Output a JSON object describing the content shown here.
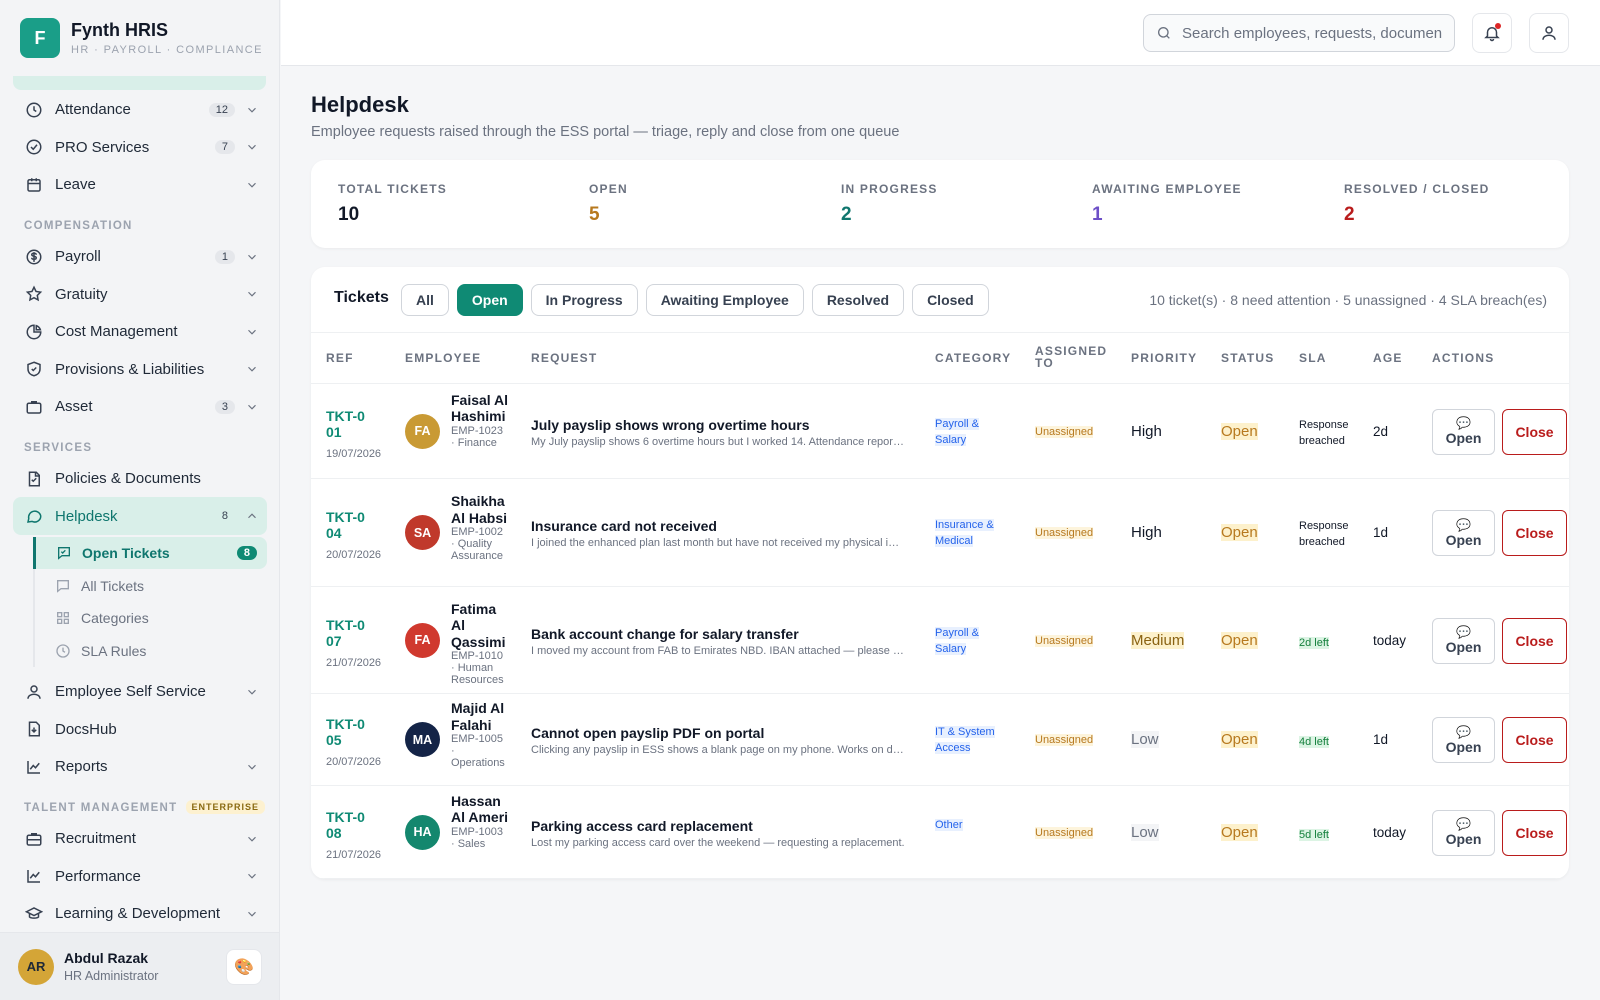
{
  "brand": {
    "logo_letter": "F",
    "name": "Fynth HRIS",
    "sub": "HR · PAYROLL · COMPLIANCE"
  },
  "sidebar": {
    "items_top": [
      {
        "label": "Attendance",
        "badge": "12",
        "icon": "clock-icon"
      },
      {
        "label": "PRO Services",
        "badge": "7",
        "icon": "check-circle-icon"
      },
      {
        "label": "Leave",
        "badge": "",
        "icon": "calendar-icon"
      }
    ],
    "section_compensation": "COMPENSATION",
    "items_comp": [
      {
        "label": "Payroll",
        "badge": "1",
        "icon": "dollar-icon"
      },
      {
        "label": "Gratuity",
        "badge": "",
        "icon": "star-icon"
      },
      {
        "label": "Cost Management",
        "badge": "",
        "icon": "pie-chart-icon"
      },
      {
        "label": "Provisions & Liabilities",
        "badge": "",
        "icon": "shield-icon"
      },
      {
        "label": "Asset",
        "badge": "3",
        "icon": "briefcase-icon"
      }
    ],
    "section_services": "SERVICES",
    "policies": "Policies & Documents",
    "helpdesk": {
      "label": "Helpdesk",
      "badge": "8"
    },
    "helpdesk_sub": [
      {
        "label": "Open Tickets",
        "badge": "8"
      },
      {
        "label": "All Tickets"
      },
      {
        "label": "Categories"
      },
      {
        "label": "SLA Rules"
      }
    ],
    "ess": "Employee Self Service",
    "docshub": "DocsHub",
    "reports": "Reports",
    "section_talent": "TALENT MANAGEMENT",
    "enterprise_badge": "ENTERPRISE",
    "items_talent": [
      {
        "label": "Recruitment"
      },
      {
        "label": "Performance"
      },
      {
        "label": "Learning & Development"
      }
    ]
  },
  "user": {
    "initials": "AR",
    "name": "Abdul Razak",
    "role": "HR Administrator"
  },
  "search": {
    "placeholder": "Search employees, requests, documents..."
  },
  "page": {
    "title": "Helpdesk",
    "subtitle": "Employee requests raised through the ESS portal — triage, reply and close from one queue"
  },
  "stats": [
    {
      "label": "TOTAL TICKETS",
      "value": "10",
      "color": "#111827"
    },
    {
      "label": "OPEN",
      "value": "5",
      "color": "#b7791f"
    },
    {
      "label": "IN PROGRESS",
      "value": "2",
      "color": "#0f766e"
    },
    {
      "label": "AWAITING EMPLOYEE",
      "value": "1",
      "color": "#6d4fc7"
    },
    {
      "label": "RESOLVED / CLOSED",
      "value": "2",
      "color": "#b91c1c"
    }
  ],
  "tickets": {
    "title": "Tickets",
    "filters": [
      "All",
      "Open",
      "In Progress",
      "Awaiting Employee",
      "Resolved",
      "Closed"
    ],
    "meta": "10 ticket(s) · 8 need attention · 5 unassigned · 4 SLA breach(es)",
    "columns": [
      "REF",
      "EMPLOYEE",
      "REQUEST",
      "CATEGORY",
      "ASSIGNED TO",
      "PRIORITY",
      "STATUS",
      "SLA",
      "AGE",
      "ACTIONS"
    ],
    "open_label": "Open",
    "close_label": "Close",
    "rows": [
      {
        "ref": "TKT-001",
        "date": "19/07/2026",
        "initials": "FA",
        "avatar_color": "#c99a34",
        "name": "Faisal Al Hashimi",
        "emp": "EMP-1023 · Finance",
        "title": "July payslip shows wrong overtime hours",
        "desc": "My July payslip shows 6 overtime hours but I worked 14. Attendance report attached.",
        "category": "Payroll & Salary",
        "assigned": "Unassigned",
        "priority": "High",
        "status": "Open",
        "sla": "Response breached",
        "age": "2d"
      },
      {
        "ref": "TKT-004",
        "date": "20/07/2026",
        "initials": "SA",
        "avatar_color": "#c0392b",
        "name": "Shaikha Al Habsi",
        "emp": "EMP-1002 · Quality Assurance",
        "title": "Insurance card not received",
        "desc": "I joined the enhanced plan last month but have not received my physical insurance card.",
        "category": "Insurance & Medical",
        "assigned": "Unassigned",
        "priority": "High",
        "status": "Open",
        "sla": "Response breached",
        "age": "1d"
      },
      {
        "ref": "TKT-007",
        "date": "21/07/2026",
        "initials": "FA",
        "avatar_color": "#d0392e",
        "name": "Fatima Al Qassimi",
        "emp": "EMP-1010 · Human Resources",
        "title": "Bank account change for salary transfer",
        "desc": "I moved my account from FAB to Emirates NBD. IBAN attached — please update before payroll.",
        "category": "Payroll & Salary",
        "assigned": "Unassigned",
        "priority": "Medium",
        "status": "Open",
        "sla": "2d left",
        "age": "today"
      },
      {
        "ref": "TKT-005",
        "date": "20/07/2026",
        "initials": "MA",
        "avatar_color": "#142447",
        "name": "Majid Al Falahi",
        "emp": "EMP-1005 · Operations",
        "title": "Cannot open payslip PDF on portal",
        "desc": "Clicking any payslip in ESS shows a blank page on my phone. Works on desktop.",
        "category": "IT & System Access",
        "assigned": "Unassigned",
        "priority": "Low",
        "status": "Open",
        "sla": "4d left",
        "age": "1d"
      },
      {
        "ref": "TKT-008",
        "date": "21/07/2026",
        "initials": "HA",
        "avatar_color": "#14876e",
        "name": "Hassan Al Ameri",
        "emp": "EMP-1003 · Sales",
        "title": "Parking access card replacement",
        "desc": "Lost my parking access card over the weekend — requesting a replacement.",
        "category": "Other",
        "assigned": "Unassigned",
        "priority": "Low",
        "status": "Open",
        "sla": "5d left",
        "age": "today"
      }
    ]
  }
}
